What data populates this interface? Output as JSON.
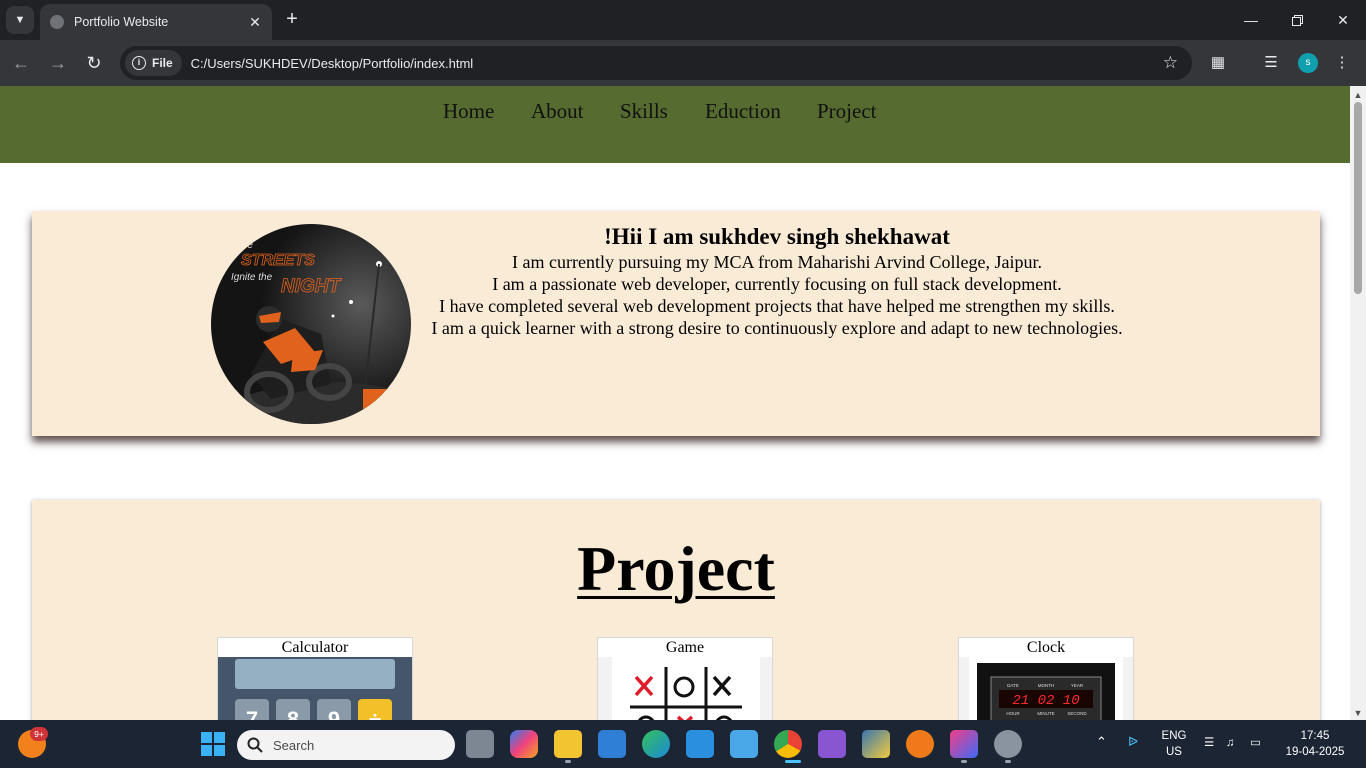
{
  "browser": {
    "tab_title": "Portfolio Website",
    "file_chip": "File",
    "url": "C:/Users/SUKHDEV/Desktop/Portfolio/index.html",
    "profile_initial": "s"
  },
  "site": {
    "nav": [
      "Home",
      "About",
      "Skills",
      "Eduction",
      "Project"
    ],
    "intro": {
      "heading": "!Hii I am sukhdev singh shekhawat",
      "lines": [
        "I am currently pursuing my MCA from Maharishi Arvind College, Jaipur.",
        "I am a passionate web developer, currently focusing on full stack development.",
        "I have completed several web development projects that have helped me strengthen my skills.",
        "I am a quick learner with a strong desire to continuously explore and adapt to new technologies."
      ],
      "avatar_text": [
        "the",
        "STREETS",
        "Ignite the",
        "NIGHT"
      ]
    },
    "project_section": {
      "title": "Project",
      "items": [
        {
          "label": "Calculator"
        },
        {
          "label": "Game"
        },
        {
          "label": "Clock"
        }
      ],
      "clock_display": "21 02 10",
      "clock_headers": [
        "DATE",
        "MONTH",
        "YEAR"
      ],
      "clock_footers": [
        "HOUR",
        "MINUTE",
        "SECOND"
      ]
    }
  },
  "taskbar": {
    "notification_badge": "9+",
    "search_placeholder": "Search",
    "language": "ENG",
    "region": "US",
    "time": "17:45",
    "date": "19-04-2025"
  }
}
